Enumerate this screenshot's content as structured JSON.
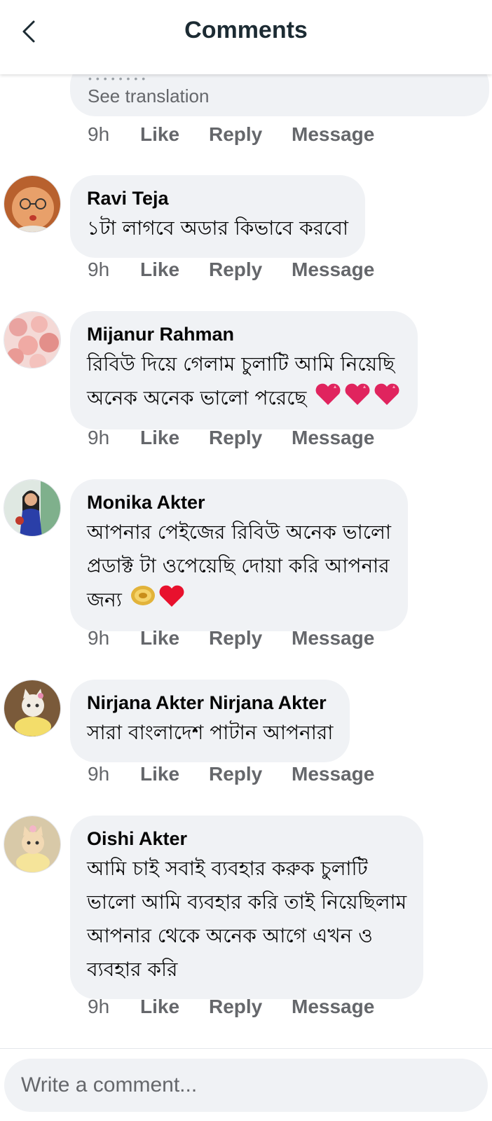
{
  "header": {
    "title": "Comments"
  },
  "partial": {
    "see_translation": "See translation",
    "time": "9h"
  },
  "actions": {
    "like": "Like",
    "reply": "Reply",
    "message": "Message"
  },
  "comments": [
    {
      "author": "Ravi Teja",
      "lines": [
        "১টা লাগবে অডার কিভাবে করবো"
      ],
      "time": "9h",
      "avatar": "avatar-baby"
    },
    {
      "author": "Mijanur Rahman",
      "lines": [
        "রিবিউ দিয়ে গেলাম চুলাটি আমি নিয়েছি",
        "অনেক অনেক ভালো পরেছে"
      ],
      "emoji": [
        "heart-icon",
        "heart-icon",
        "heart-icon"
      ],
      "time": "9h",
      "avatar": "avatar-roses"
    },
    {
      "author": "Monika Akter",
      "lines": [
        "আপনার পেইজের রিবিউ অনেক ভালো",
        "প্রডাক্ট টা ওপেয়েছি দোয়া করি আপনার",
        "জন্য"
      ],
      "emoji": [
        "coin-icon",
        "red-heart-icon"
      ],
      "time": "9h",
      "avatar": "avatar-woman"
    },
    {
      "author": "Nirjana Akter Nirjana Akter",
      "lines": [
        "সারা বাংলাদেশ পাটান আপনারা"
      ],
      "time": "9h",
      "avatar": "avatar-cat"
    },
    {
      "author": "Oishi Akter",
      "lines": [
        "আমি চাই সবাই ব্যবহার করুক চুলাটি",
        "ভালো আমি ব্যবহার করি তাই নিয়েছিলাম",
        "আপনার থেকে অনেক আগে এখন ও",
        "ব্যবহার করি"
      ],
      "time": "9h",
      "avatar": "avatar-kitten"
    }
  ],
  "composer": {
    "placeholder": "Write a comment..."
  },
  "colors": {
    "bubble": "#f0f2f5",
    "meta": "#65676b",
    "title": "#1c2b33",
    "heart": "#e0245e"
  }
}
